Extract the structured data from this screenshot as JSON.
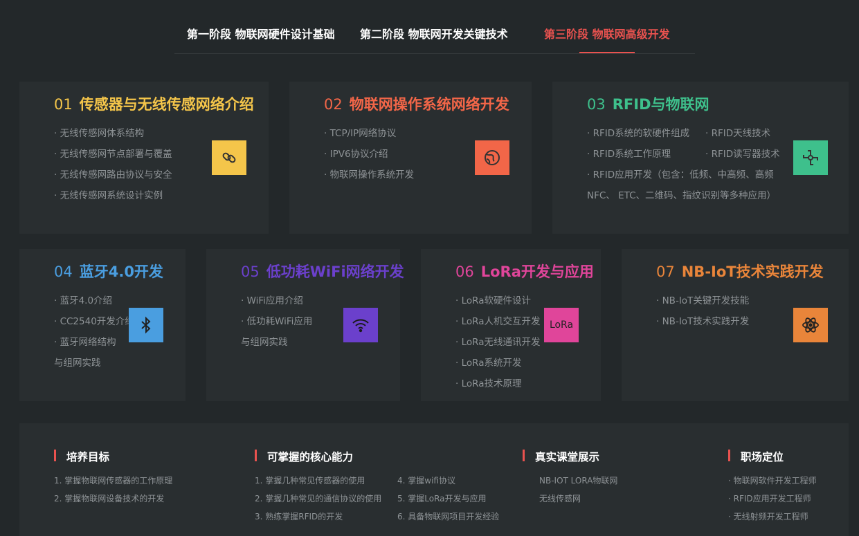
{
  "tabs": [
    {
      "label": "第一阶段 物联网硬件设计基础"
    },
    {
      "label": "第二阶段 物联网开发关键技术"
    },
    {
      "label": "第三阶段 物联网高级开发"
    }
  ],
  "colors": {
    "active_tab": "#e9524f",
    "card1": "#f4c54a",
    "card2": "#f26648",
    "card3": "#3ec08c",
    "card4": "#4a9ee0",
    "card5": "#6b40cc",
    "card6": "#e0459a",
    "card7": "#e9853a"
  },
  "cards": [
    {
      "num": "01",
      "title": "传感器与无线传感网络介绍",
      "icon": "link-icon",
      "items": [
        "· 无线传感网体系结构",
        "· 无线传感网节点部署与覆盖",
        "· 无线传感网路由协议与安全",
        "· 无线传感网系统设计实例"
      ]
    },
    {
      "num": "02",
      "title": "物联网操作系统网络开发",
      "icon": "globe-icon",
      "items": [
        "· TCP/IP网络协议",
        "· IPV6协议介绍",
        "· 物联网操作系统开发"
      ]
    },
    {
      "num": "03",
      "title": "RFID与物联网",
      "icon": "rfid-icon",
      "items": [
        "· RFID系统的软硬件组成",
        "· RFID天线技术",
        "· RFID系统工作原理",
        "· RFID读写器技术",
        "· RFID应用开发（包含：低频、中高频、高频",
        "NFC、 ETC、二维码、指纹识别等多种应用）"
      ]
    },
    {
      "num": "04",
      "title": "蓝牙4.0开发",
      "icon": "bluetooth-icon",
      "items": [
        "· 蓝牙4.0介绍",
        "· CC2540开发介绍",
        "· 蓝牙网络结构",
        "与组网实践"
      ]
    },
    {
      "num": "05",
      "title": "低功耗WiFi网络开发",
      "icon": "wifi-icon",
      "items": [
        "· WiFi应用介绍",
        "· 低功耗WiFi应用",
        "与组网实践"
      ]
    },
    {
      "num": "06",
      "title": "LoRa开发与应用",
      "icon": "lora-icon",
      "icon_text": "LoRa",
      "items": [
        "· LoRa软硬件设计",
        "· LoRa人机交互开发",
        "· LoRa无线通讯开发",
        "· LoRa系统开发",
        "· LoRa技术原理"
      ]
    },
    {
      "num": "07",
      "title": "NB-IoT技术实践开发",
      "icon": "atom-icon",
      "items": [
        "· NB-IoT关键开发技能",
        "· NB-IoT技术实践开发"
      ]
    }
  ],
  "bottom": {
    "goals": {
      "title": "培养目标",
      "items": [
        "1. 掌握物联网传感器的工作原理",
        "2. 掌握物联网设备技术的开发"
      ]
    },
    "abilities": {
      "title": "可掌握的核心能力",
      "items": [
        "1. 掌握几种常见传感器的使用",
        "2. 掌握几种常见的通信协议的使用",
        "3. 熟练掌握RFID的开发",
        "4. 掌握wifi协议",
        "5. 掌握LoRa开发与应用",
        "6. 具备物联网项目开发经验"
      ]
    },
    "classroom": {
      "title": "真实课堂展示",
      "items": [
        "NB-IOT LORA物联网",
        "无线传感网"
      ]
    },
    "career": {
      "title": "职场定位",
      "items": [
        "· 物联网软件开发工程师",
        "· RFID应用开发工程师",
        "· 无线射频开发工程师"
      ]
    }
  }
}
